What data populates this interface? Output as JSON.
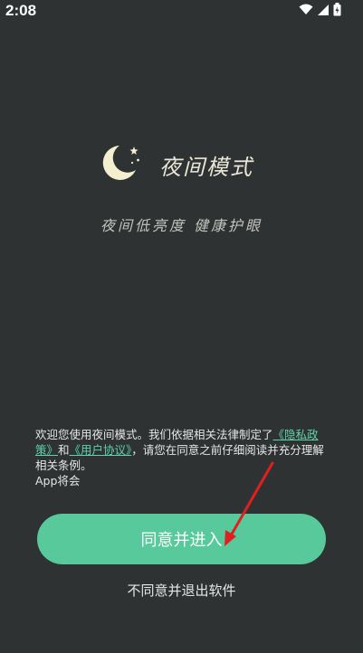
{
  "status_bar": {
    "time": "2:08",
    "icons": [
      "wifi-icon",
      "signal-icon",
      "battery-icon"
    ]
  },
  "app": {
    "title": "夜间模式",
    "slogan": "夜间低亮度 健康护眼",
    "logo_icon": "moon-stars-icon"
  },
  "agreement": {
    "prefix": "欢迎您使用夜间模式。我们依据相关法律制定了",
    "privacy_link": "《隐私政策》",
    "and": "和",
    "user_link": "《用户协议》",
    "suffix": "，请您在同意之前仔细阅读并充分理解相关条例。",
    "line_extra": "App将会"
  },
  "buttons": {
    "agree_label": "同意并进入",
    "disagree_label": "不同意并退出软件"
  },
  "colors": {
    "background": "#2e3233",
    "accent": "#57c99a",
    "link": "#5fd3a8",
    "annotation_arrow": "#e02020"
  }
}
